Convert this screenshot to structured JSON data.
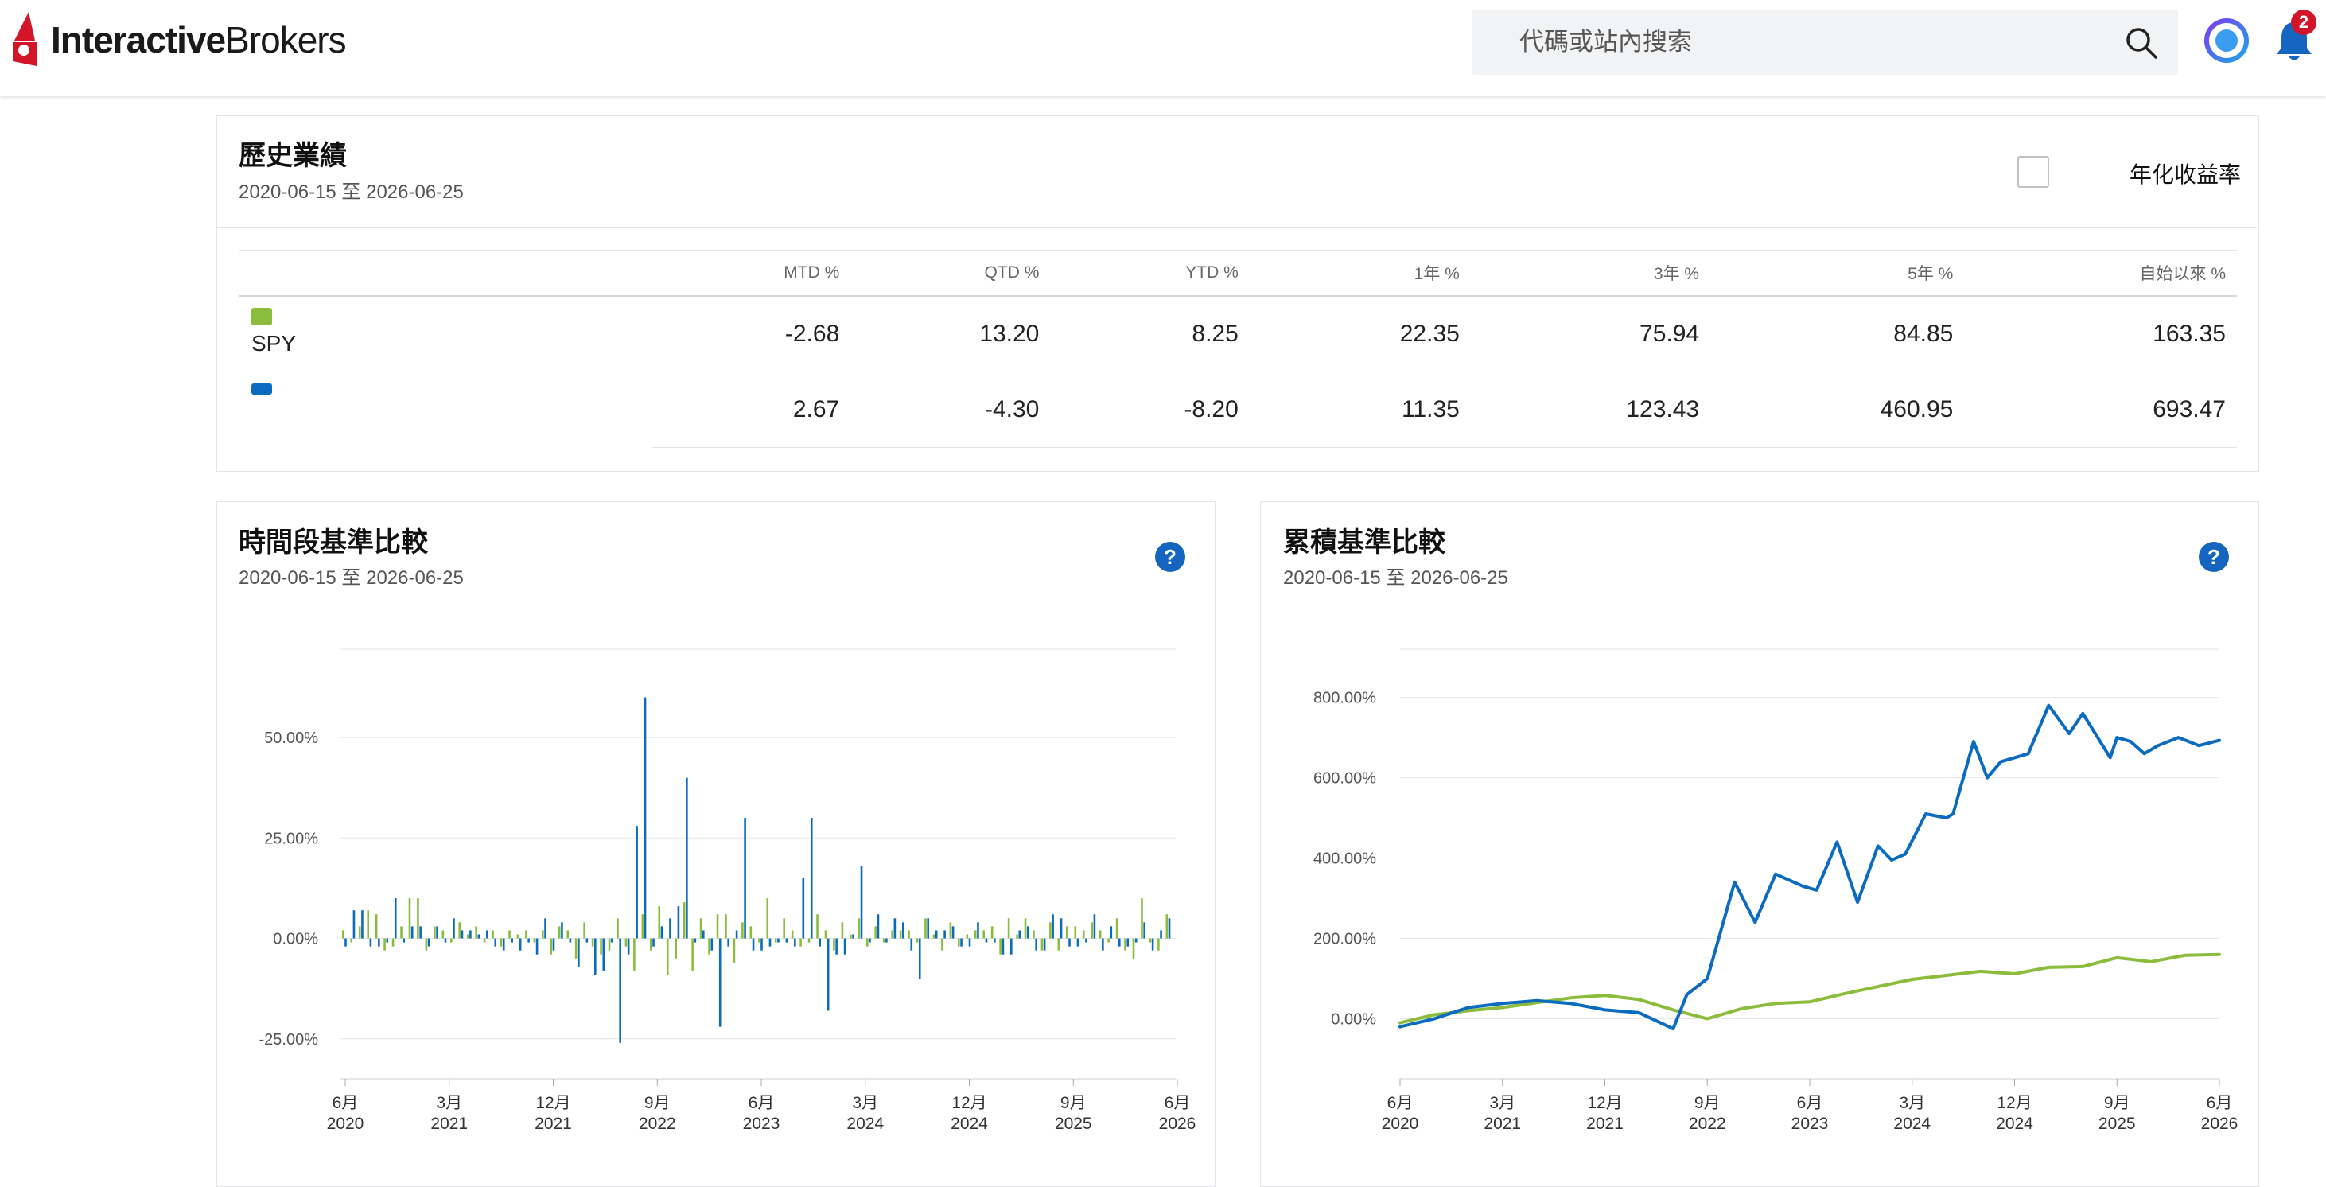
{
  "header": {
    "logo_part1": "Interactive",
    "logo_part2": "Brokers",
    "search_placeholder": "代碼或站內搜索",
    "notification_count": "2"
  },
  "historical": {
    "title": "歷史業績",
    "date_range": "2020-06-15 至 2026-06-25",
    "annualized_label": "年化收益率",
    "columns": [
      "MTD %",
      "QTD %",
      "YTD %",
      "1年 %",
      "3年 %",
      "5年 %",
      "自始以來 %"
    ],
    "rows": [
      {
        "name": "SPY",
        "color": "#8bbc3c",
        "values": [
          "-2.68",
          "13.20",
          "8.25",
          "22.35",
          "75.94",
          "84.85",
          "163.35"
        ]
      },
      {
        "name": "",
        "color": "#0a6bbf",
        "values": [
          "2.67",
          "-4.30",
          "-8.20",
          "11.35",
          "123.43",
          "460.95",
          "693.47"
        ]
      }
    ]
  },
  "period_chart": {
    "title": "時間段基準比較",
    "date_range": "2020-06-15 至 2026-06-25"
  },
  "cumulative_chart": {
    "title": "累積基準比較",
    "date_range": "2020-06-15 至 2026-06-25"
  },
  "colors": {
    "spy": "#8bbc3c",
    "portfolio": "#0a6bbf",
    "accent": "#1565c0"
  },
  "chart_data": [
    {
      "type": "bar",
      "title": "時間段基準比較",
      "yticks": [
        "50.00%",
        "25.00%",
        "0.00%",
        "-25.00%"
      ],
      "ylim": [
        -30,
        72
      ],
      "xticks": [
        [
          "6月",
          "2020"
        ],
        [
          "3月",
          "2021"
        ],
        [
          "12月",
          "2021"
        ],
        [
          "9月",
          "2022"
        ],
        [
          "6月",
          "2023"
        ],
        [
          "3月",
          "2024"
        ],
        [
          "12月",
          "2024"
        ],
        [
          "9月",
          "2025"
        ],
        [
          "6月",
          "2026"
        ]
      ],
      "x_start": "2020-06",
      "x_end": "2026-06",
      "series": [
        {
          "name": "SPY",
          "values": [
            2,
            -1,
            3,
            7,
            6,
            -3,
            -2,
            3,
            10,
            10,
            -3,
            3,
            2,
            -1,
            4,
            1,
            3,
            -1,
            2,
            -2,
            2,
            1,
            2,
            -1,
            2,
            -4,
            3,
            2,
            -5,
            4,
            -2,
            -4,
            -3,
            5,
            -2,
            -8,
            6,
            -3,
            8,
            -9,
            -5,
            9,
            -8,
            5,
            -4,
            6,
            6,
            -6,
            4,
            3,
            -1,
            10,
            -1,
            5,
            2,
            -2,
            -1,
            6,
            2,
            -3,
            4,
            1,
            5,
            -2,
            3,
            -1,
            2,
            2,
            2,
            -1,
            5,
            1,
            -3,
            4,
            -2,
            1,
            2,
            2,
            3,
            -4,
            5,
            1,
            5,
            2,
            -3,
            4,
            -3,
            3,
            3,
            2,
            4,
            2,
            -1,
            5,
            -3,
            -5,
            10,
            -1,
            -3,
            6
          ]
        },
        {
          "name": "",
          "values": [
            -2,
            7,
            7,
            -2,
            -2,
            -1,
            10,
            -1,
            3,
            3,
            -2,
            3,
            -1,
            5,
            2,
            2,
            1,
            2,
            -2,
            -3,
            -1,
            -3,
            -1,
            -4,
            5,
            -3,
            4,
            -1,
            -7,
            -1,
            -9,
            -8,
            -1,
            -26,
            -4,
            28,
            60,
            -2,
            3,
            5,
            8,
            40,
            -1,
            2,
            -3,
            -22,
            -2,
            2,
            30,
            -3,
            -3,
            -2,
            -1,
            -1,
            -2,
            15,
            30,
            -2,
            -18,
            -4,
            -4,
            1,
            18,
            -1,
            6,
            -1,
            5,
            4,
            -3,
            -10,
            5,
            2,
            2,
            3,
            -2,
            -2,
            4,
            -1,
            -1,
            -4,
            -4,
            2,
            3,
            -3,
            -3,
            6,
            5,
            -2,
            -2,
            -1,
            6,
            -3,
            3,
            -2,
            -2,
            -1,
            4,
            -3,
            2,
            5
          ]
        }
      ]
    },
    {
      "type": "line",
      "title": "累積基準比較",
      "yticks": [
        "800.00%",
        "600.00%",
        "400.00%",
        "200.00%",
        "0.00%"
      ],
      "ylim": [
        -100,
        920
      ],
      "xticks": [
        [
          "6月",
          "2020"
        ],
        [
          "3月",
          "2021"
        ],
        [
          "12月",
          "2021"
        ],
        [
          "9月",
          "2022"
        ],
        [
          "6月",
          "2023"
        ],
        [
          "3月",
          "2024"
        ],
        [
          "12月",
          "2024"
        ],
        [
          "9月",
          "2025"
        ],
        [
          "6月",
          "2026"
        ]
      ],
      "x_start": "2020-06",
      "x_end": "2026-06",
      "series": [
        {
          "name": "SPY",
          "x": [
            0,
            0.25,
            0.5,
            0.75,
            1,
            1.25,
            1.5,
            1.75,
            2,
            2.25,
            2.5,
            2.75,
            3,
            3.25,
            3.5,
            3.75,
            4,
            4.25,
            4.5,
            4.75,
            5,
            5.25,
            5.5,
            5.75,
            6
          ],
          "values": [
            -10,
            10,
            20,
            28,
            40,
            52,
            58,
            48,
            22,
            0,
            25,
            38,
            42,
            62,
            80,
            98,
            108,
            118,
            112,
            128,
            130,
            152,
            142,
            158,
            160
          ]
        },
        {
          "name": "",
          "x": [
            0,
            0.25,
            0.5,
            0.75,
            1,
            1.25,
            1.5,
            1.75,
            2,
            2.1,
            2.25,
            2.45,
            2.6,
            2.75,
            2.95,
            3.05,
            3.2,
            3.35,
            3.5,
            3.6,
            3.7,
            3.85,
            4,
            4.05,
            4.2,
            4.3,
            4.4,
            4.6,
            4.75,
            4.9,
            5,
            5.2,
            5.25,
            5.35,
            5.45,
            5.55,
            5.7,
            5.85,
            6
          ],
          "values": [
            -20,
            0,
            28,
            38,
            45,
            38,
            22,
            15,
            -25,
            60,
            100,
            340,
            240,
            360,
            330,
            320,
            440,
            290,
            430,
            395,
            410,
            510,
            500,
            510,
            690,
            600,
            640,
            660,
            780,
            710,
            760,
            650,
            700,
            690,
            660,
            680,
            700,
            680,
            693
          ]
        }
      ]
    }
  ]
}
